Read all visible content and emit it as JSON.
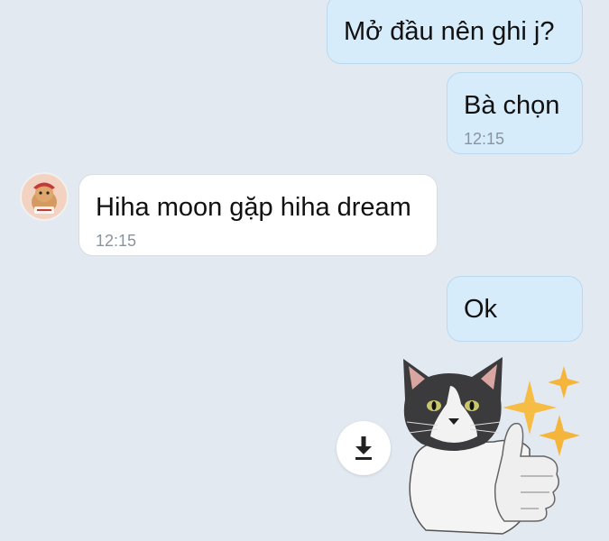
{
  "messages": [
    {
      "direction": "outgoing",
      "text": "Mở đầu nên ghi j?",
      "time": ""
    },
    {
      "direction": "outgoing",
      "text": "Bà chọn",
      "time": "12:15"
    },
    {
      "direction": "incoming",
      "text": "Hiha moon gặp hiha dream",
      "time": "12:15"
    },
    {
      "direction": "outgoing",
      "text": "Ok",
      "time": ""
    }
  ],
  "sticker": {
    "icon": "cat-thumbs-up-sticker"
  },
  "download": {
    "icon": "download-icon"
  },
  "colors": {
    "background": "#e3e9f1",
    "outgoing_bubble": "#d6ecfb",
    "incoming_bubble": "#ffffff",
    "time_text": "#8a949e"
  }
}
